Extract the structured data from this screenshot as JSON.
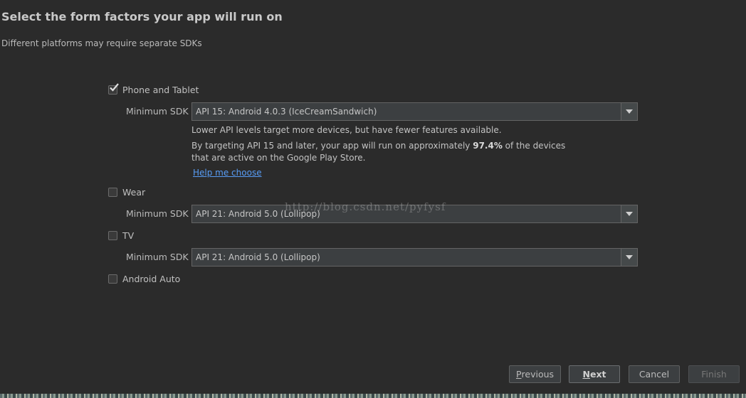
{
  "header": {
    "title": "Select the form factors your app will run on",
    "subtitle": "Different platforms may require separate SDKs"
  },
  "form_factors": [
    {
      "label": "Phone and Tablet",
      "checked": true,
      "min_sdk_label": "Minimum SDK",
      "min_sdk_value": "API 15: Android 4.0.3 (IceCreamSandwich)",
      "info_line1": "Lower API levels target more devices, but have fewer features available.",
      "info_line2_pre": "By targeting API 15 and later, your app will run on approximately ",
      "info_line2_pct": "97.4%",
      "info_line2_post": " of the devices",
      "info_line3": "that are active on the Google Play Store.",
      "help_link": "Help me choose"
    },
    {
      "label": "Wear",
      "checked": false,
      "min_sdk_label": "Minimum SDK",
      "min_sdk_value": "API 21: Android 5.0 (Lollipop)"
    },
    {
      "label": "TV",
      "checked": false,
      "min_sdk_label": "Minimum SDK",
      "min_sdk_value": "API 21: Android 5.0 (Lollipop)"
    },
    {
      "label": "Android Auto",
      "checked": false
    }
  ],
  "watermark": "http://blog.csdn.net/pyfysf",
  "buttons": {
    "previous_first": "P",
    "previous_rest": "revious",
    "next_first": "N",
    "next_rest": "ext",
    "cancel": "Cancel",
    "finish": "Finish"
  },
  "icons": {
    "check": "checkmark-icon",
    "dropdown": "chevron-down-icon"
  },
  "colors": {
    "background": "#2b2b2b",
    "link": "#589df6",
    "field": "#3c3f41"
  }
}
